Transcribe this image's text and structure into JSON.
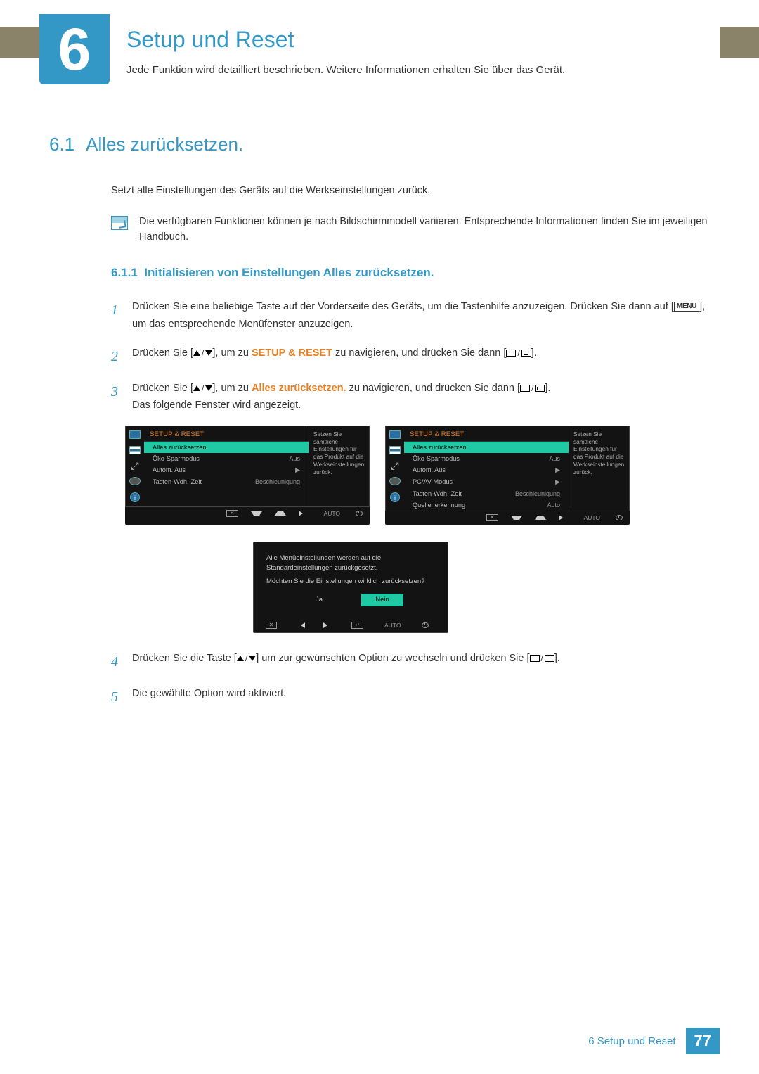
{
  "chapter": {
    "number": "6",
    "title": "Setup und Reset",
    "subtitle": "Jede Funktion wird detailliert beschrieben. Weitere Informationen erhalten Sie über das Gerät."
  },
  "section": {
    "number": "6.1",
    "title": "Alles zurücksetzen.",
    "intro": "Setzt alle Einstellungen des Geräts auf die Werkseinstellungen zurück.",
    "note": "Die verfügbaren Funktionen können je nach Bildschirmmodell variieren. Entsprechende Informationen finden Sie im jeweiligen Handbuch."
  },
  "subsection": {
    "number": "6.1.1",
    "title": "Initialisieren von Einstellungen Alles zurücksetzen."
  },
  "steps": {
    "s1_a": "Drücken Sie eine beliebige Taste auf der Vorderseite des Geräts, um die Tastenhilfe anzuzeigen. Drücken Sie dann auf [",
    "s1_menu": "MENU",
    "s1_b": "], um das entsprechende Menüfenster anzuzeigen.",
    "s2_a": "Drücken Sie [",
    "s2_mid": "], um zu ",
    "s2_target": "SETUP & RESET",
    "s2_b": " zu navigieren, und drücken Sie dann [",
    "s2_c": "].",
    "s3_a": "Drücken Sie [",
    "s3_mid": "], um zu ",
    "s3_target": "Alles zurücksetzen.",
    "s3_b": " zu navigieren, und drücken Sie dann [",
    "s3_c": "].",
    "s3_follow": "Das folgende Fenster wird angezeigt.",
    "s4_a": "Drücken Sie die Taste [",
    "s4_mid": "] um zur gewünschten Option zu wechseln und drücken Sie [",
    "s4_b": "].",
    "s5": "Die gewählte Option wird aktiviert."
  },
  "osd_common": {
    "title": "SETUP & RESET",
    "help": "Setzen Sie sämtliche Einstellungen für das Produkt auf die Werkseinstellungen zurück.",
    "auto": "AUTO"
  },
  "osd_a": {
    "items": [
      {
        "label": "Alles zurücksetzen.",
        "value": "",
        "sel": true
      },
      {
        "label": "Öko-Sparmodus",
        "value": "Aus"
      },
      {
        "label": "Autom. Aus",
        "value": "▶"
      },
      {
        "label": "Tasten-Wdh.-Zeit",
        "value": "Beschleunigung"
      }
    ]
  },
  "osd_b": {
    "items": [
      {
        "label": "Alles zurücksetzen.",
        "value": "",
        "sel": true
      },
      {
        "label": "Öko-Sparmodus",
        "value": "Aus"
      },
      {
        "label": "Autom. Aus",
        "value": "▶"
      },
      {
        "label": "PC/AV-Modus",
        "value": "▶"
      },
      {
        "label": "Tasten-Wdh.-Zeit",
        "value": "Beschleunigung"
      },
      {
        "label": "Quellenerkennung",
        "value": "Auto"
      }
    ]
  },
  "dialog": {
    "line1": "Alle Menüeinstellungen werden auf die Standardeinstellungen zurückgesetzt.",
    "line2": "Möchten Sie die Einstellungen wirklich zurücksetzen?",
    "yes": "Ja",
    "no": "Nein",
    "auto": "AUTO"
  },
  "footer": {
    "trail": "6 Setup und Reset",
    "page": "77"
  }
}
